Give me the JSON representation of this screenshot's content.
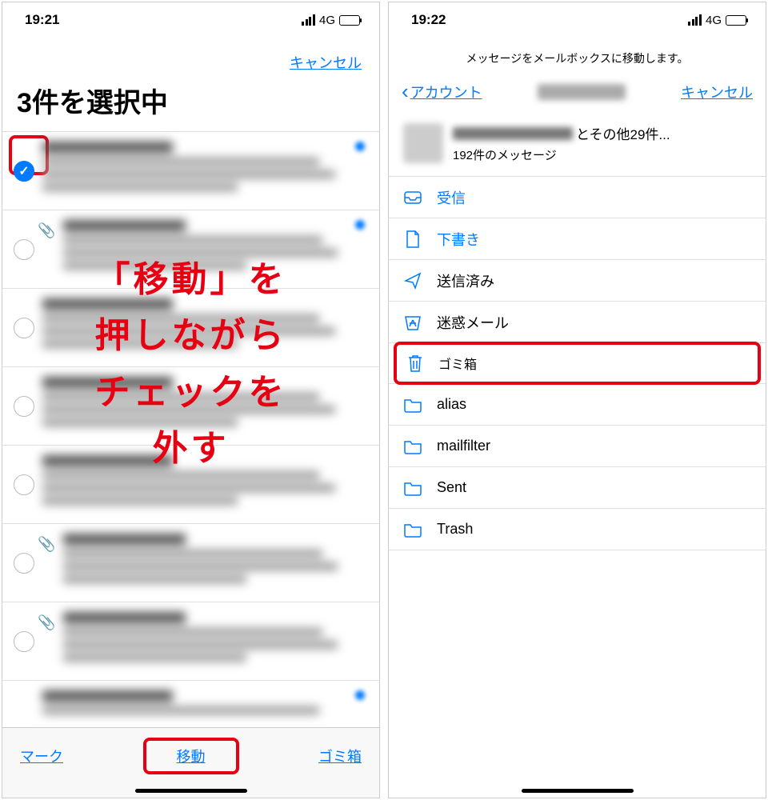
{
  "left": {
    "status": {
      "time": "19:21",
      "network": "4G"
    },
    "cancel": "キャンセル",
    "title": "3件を選択中",
    "overlay": "「移動」を\n押しながら\nチェックを\n外す",
    "toolbar": {
      "mark": "マーク",
      "move": "移動",
      "trash": "ゴミ箱"
    }
  },
  "right": {
    "status": {
      "time": "19:22",
      "network": "4G"
    },
    "subtitle": "メッセージをメールボックスに移動します。",
    "back": "アカウント",
    "cancel": "キャンセル",
    "summary": {
      "suffix": "とその他29件...",
      "count": "192件のメッセージ"
    },
    "folders": [
      {
        "icon": "inbox",
        "label": "受信",
        "blue": true
      },
      {
        "icon": "draft",
        "label": "下書き",
        "blue": true
      },
      {
        "icon": "sent",
        "label": "送信済み"
      },
      {
        "icon": "junk",
        "label": "迷惑メール"
      },
      {
        "icon": "trash",
        "label": "ゴミ箱",
        "highlight": true
      },
      {
        "icon": "folder",
        "label": "alias"
      },
      {
        "icon": "folder",
        "label": "mailfilter"
      },
      {
        "icon": "folder",
        "label": "Sent"
      },
      {
        "icon": "folder",
        "label": "Trash"
      }
    ]
  }
}
